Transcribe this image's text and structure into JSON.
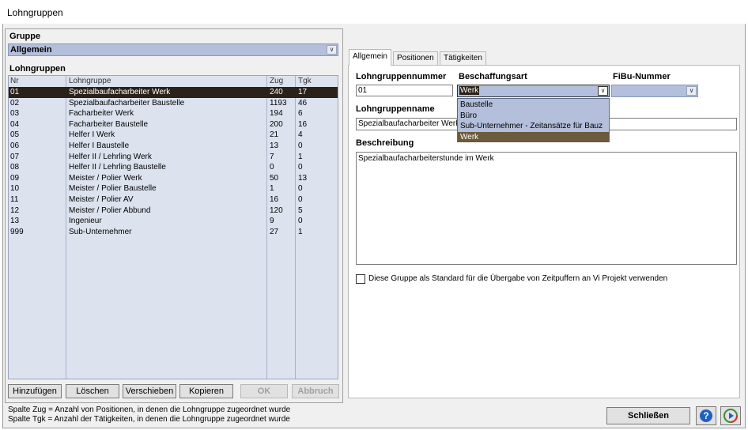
{
  "window": {
    "title": "Lohngruppen"
  },
  "gruppe": {
    "label": "Gruppe",
    "value": "Allgemein"
  },
  "lohngruppen": {
    "label": "Lohngruppen",
    "columns": [
      "Nr",
      "Lohngruppe",
      "Zug",
      "Tgk"
    ],
    "rows": [
      [
        "01",
        "Spezialbaufacharbeiter Werk",
        "240",
        "17"
      ],
      [
        "02",
        "Spezialbaufacharbeiter Baustelle",
        "1193",
        "46"
      ],
      [
        "03",
        "Facharbeiter Werk",
        "194",
        "6"
      ],
      [
        "04",
        "Facharbeiter Baustelle",
        "200",
        "16"
      ],
      [
        "05",
        "Helfer I Werk",
        "21",
        "4"
      ],
      [
        "06",
        "Helfer I Baustelle",
        "13",
        "0"
      ],
      [
        "07",
        "Helfer II / Lehrling Werk",
        "7",
        "1"
      ],
      [
        "08",
        "Helfer II / Lehrling Baustelle",
        "0",
        "0"
      ],
      [
        "09",
        "Meister / Polier Werk",
        "50",
        "13"
      ],
      [
        "10",
        "Meister / Polier Baustelle",
        "1",
        "0"
      ],
      [
        "11",
        "Meister / Polier AV",
        "16",
        "0"
      ],
      [
        "12",
        "Meister / Polier Abbund",
        "120",
        "5"
      ],
      [
        "13",
        "Ingenieur",
        "9",
        "0"
      ],
      [
        "999",
        "Sub-Unternehmer",
        "27",
        "1"
      ]
    ],
    "selected_index": 0
  },
  "buttons": {
    "add": "Hinzufügen",
    "delete": "Löschen",
    "move": "Verschieben",
    "copy": "Kopieren",
    "ok": "OK",
    "cancel": "Abbruch",
    "close": "Schließen"
  },
  "status": {
    "line1": "Spalte Zug = Anzahl von Positionen, in denen die Lohngruppe zugeordnet wurde",
    "line2": "Spalte Tgk = Anzahl der Tätigkeiten, in denen die Lohngruppe zugeordnet wurde"
  },
  "tabs": [
    "Allgemein",
    "Positionen",
    "Tätigkeiten"
  ],
  "active_tab": "Allgemein",
  "form": {
    "nummer_label": "Lohngruppennummer",
    "nummer_value": "01",
    "beschaffung_label": "Beschaffungsart",
    "beschaffung_value": "Werk",
    "beschaffung_options": [
      "Baustelle",
      "Büro",
      "Sub-Unternehmer - Zeitansätze für Bauz",
      "Werk"
    ],
    "fibu_label": "FiBu-Nummer",
    "fibu_value": "",
    "name_label": "Lohngruppenname",
    "name_value": "Spezialbaufacharbeiter Werk",
    "beschreibung_label": "Beschreibung",
    "beschreibung_value": "Spezialbaufacharbeiterstunde im Werk",
    "standard_checkbox_label": "Diese Gruppe als Standard für die Übergabe von Zeitpuffern an Vi Projekt verwenden",
    "standard_checked": false
  },
  "icons": {
    "help": "help-icon",
    "play": "play-icon",
    "dropdown": "chevron-down-icon"
  },
  "colors": {
    "selection": "#2a2118",
    "combo_bg": "#b3bfdb",
    "grid_bg": "#dce3ef",
    "highlight": "#6b5b3c"
  }
}
